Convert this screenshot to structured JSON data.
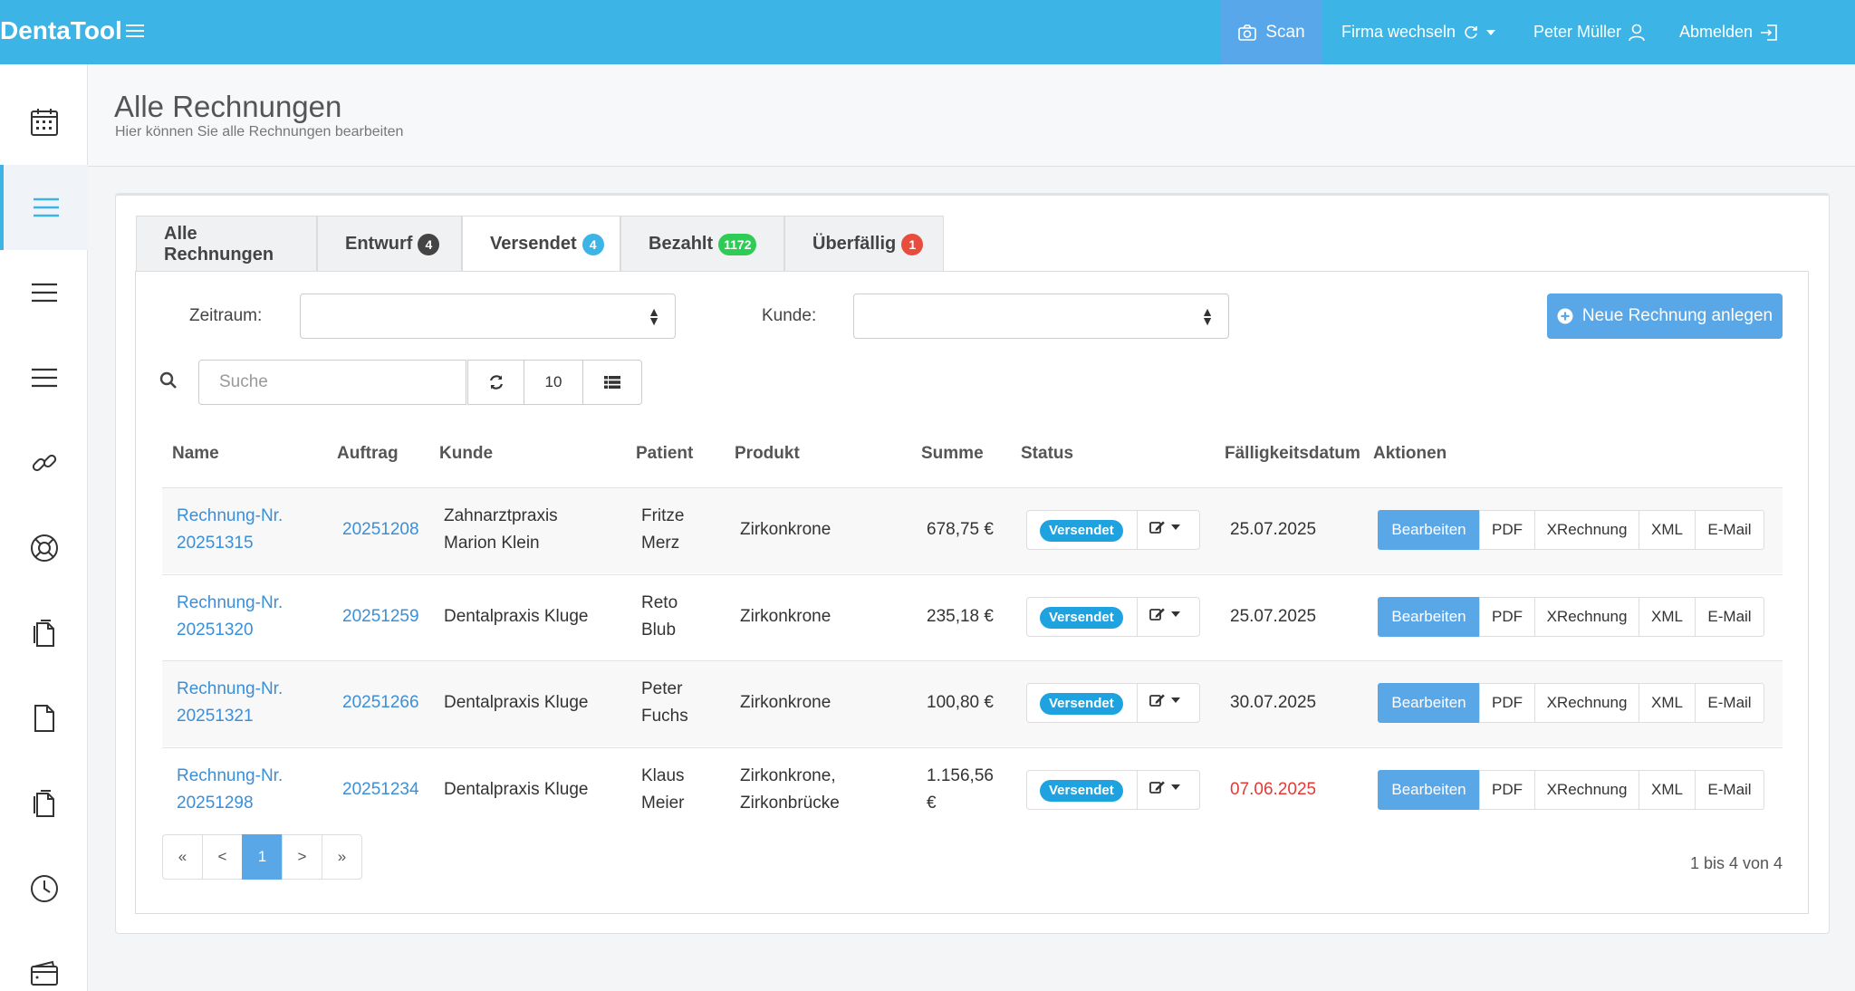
{
  "app": {
    "brand": "DentaTool"
  },
  "topbar": {
    "scan": "Scan",
    "switch_company": "Firma wechseln",
    "user": "Peter Müller",
    "logout": "Abmelden"
  },
  "sidebar": {
    "items": [
      {
        "icon": "calendar-icon"
      },
      {
        "icon": "list-icon",
        "active": true
      },
      {
        "icon": "list-icon"
      },
      {
        "icon": "list-icon"
      },
      {
        "icon": "link-icon"
      },
      {
        "icon": "lifebuoy-icon"
      },
      {
        "icon": "documents-icon"
      },
      {
        "icon": "document-icon"
      },
      {
        "icon": "documents-icon"
      },
      {
        "icon": "clock-icon"
      },
      {
        "icon": "wallet-icon"
      }
    ]
  },
  "header": {
    "title": "Alle Rechnungen",
    "subtitle": "Hier können Sie alle Rechnungen bearbeiten"
  },
  "tabs": [
    {
      "label": "Alle Rechnungen",
      "count": ""
    },
    {
      "label": "Entwurf",
      "count": "4",
      "color": "#444444"
    },
    {
      "label": "Versendet",
      "count": "4",
      "color": "#3cb4e6",
      "active": true
    },
    {
      "label": "Bezahlt",
      "count": "1172",
      "color": "#2ecc55"
    },
    {
      "label": "Überfällig",
      "count": "1",
      "color": "#e74c3c"
    }
  ],
  "filters": {
    "period_label": "Zeitraum:",
    "customer_label": "Kunde:"
  },
  "new_invoice": "Neue Rechnung anlegen",
  "toolbar": {
    "search_placeholder": "Suche",
    "page_size": "10"
  },
  "table": {
    "headers": [
      "Name",
      "Auftrag",
      "Kunde",
      "Patient",
      "Produkt",
      "Summe",
      "Status",
      "Fälligkeitsdatum",
      "Aktionen"
    ],
    "rows": [
      {
        "name1": "Rechnung-Nr.",
        "name2": "20251315",
        "order": "20251208",
        "customer1": "Zahnarztpraxis",
        "customer2": "Marion Klein",
        "patient1": "Fritze",
        "patient2": "Merz",
        "product1": "Zirkonkrone",
        "product2": "",
        "sum1": "678,75 €",
        "sum2": "",
        "status": "Versendet",
        "due": "25.07.2025",
        "overdue": false
      },
      {
        "name1": "Rechnung-Nr.",
        "name2": "20251320",
        "order": "20251259",
        "customer1": "Dentalpraxis Kluge",
        "customer2": "",
        "patient1": "Reto",
        "patient2": "Blub",
        "product1": "Zirkonkrone",
        "product2": "",
        "sum1": "235,18 €",
        "sum2": "",
        "status": "Versendet",
        "due": "25.07.2025",
        "overdue": false
      },
      {
        "name1": "Rechnung-Nr.",
        "name2": "20251321",
        "order": "20251266",
        "customer1": "Dentalpraxis Kluge",
        "customer2": "",
        "patient1": "Peter",
        "patient2": "Fuchs",
        "product1": "Zirkonkrone",
        "product2": "",
        "sum1": "100,80 €",
        "sum2": "",
        "status": "Versendet",
        "due": "30.07.2025",
        "overdue": false
      },
      {
        "name1": "Rechnung-Nr.",
        "name2": "20251298",
        "order": "20251234",
        "customer1": "Dentalpraxis Kluge",
        "customer2": "",
        "patient1": "Klaus",
        "patient2": "Meier",
        "product1": "Zirkonkrone,",
        "product2": "Zirkonbrücke",
        "sum1": "1.156,56",
        "sum2": "€",
        "status": "Versendet",
        "due": "07.06.2025",
        "overdue": true
      }
    ],
    "actions": [
      "Bearbeiten",
      "PDF",
      "XRechnung",
      "XML",
      "E-Mail"
    ]
  },
  "pagination": {
    "first": "«",
    "prev": "<",
    "current": "1",
    "next": ">",
    "last": "»",
    "range": "1 bis 4 von 4"
  },
  "colors": {
    "topbar": "#3cb4e6",
    "primary": "#5aa7e8",
    "link": "#3a8fd8",
    "overdue": "#e53935"
  }
}
